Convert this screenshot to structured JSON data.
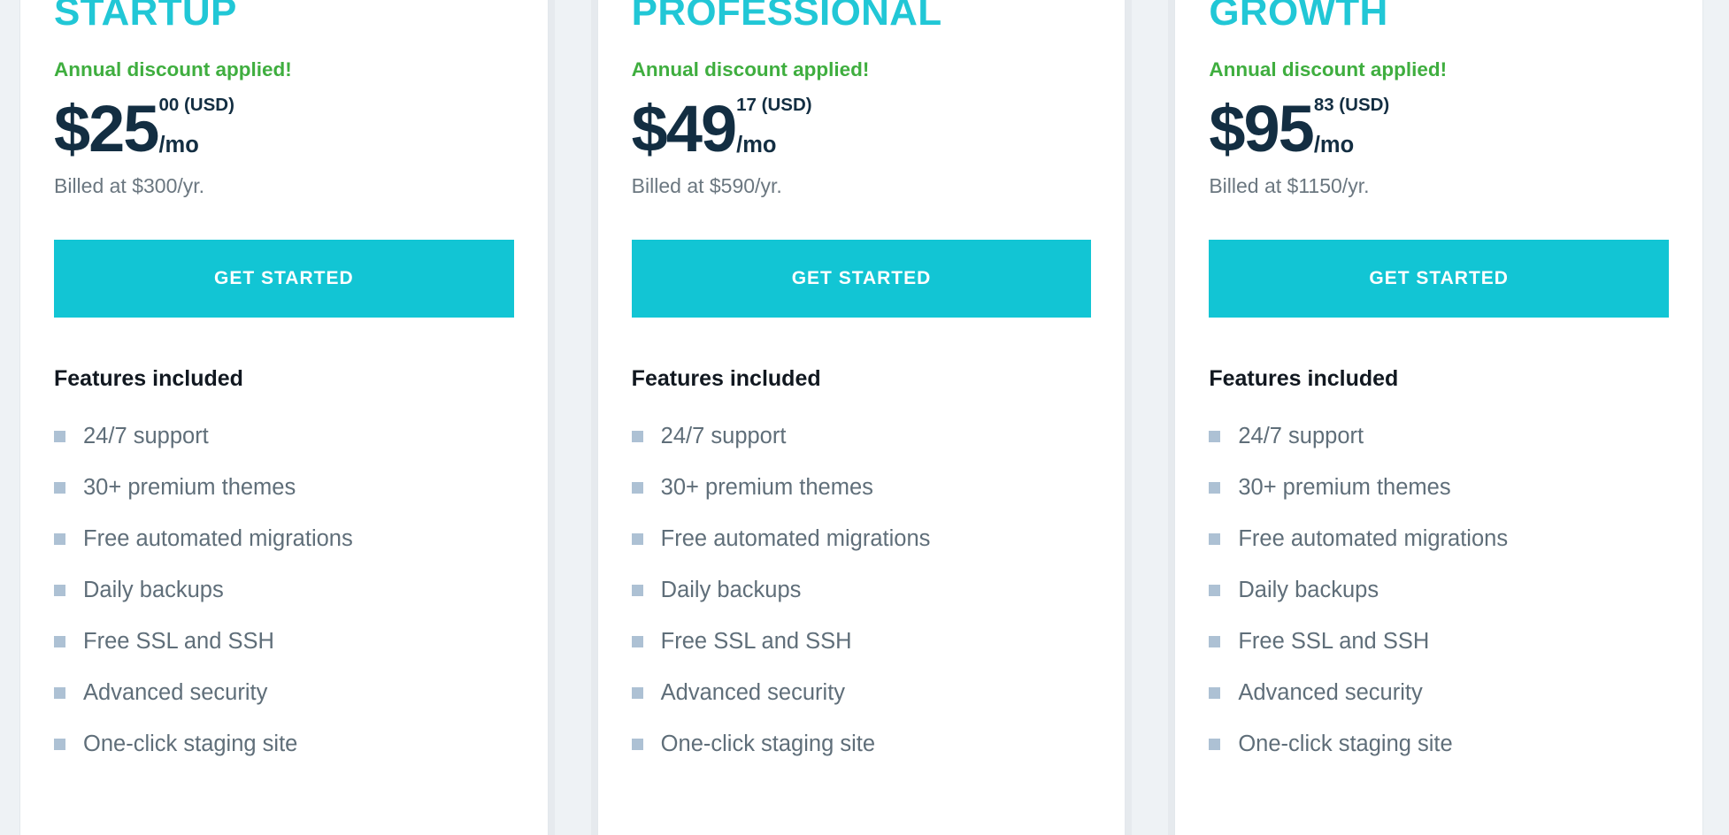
{
  "theme": {
    "accent_cyan": "#12c5d4",
    "title_cyan": "#21c7d6",
    "discount_green": "#3fae3f",
    "price_navy": "#132e42",
    "muted_gray": "#6b7780",
    "feature_gray": "#5f6e79",
    "bullet_blue": "#adc1d4",
    "page_bg": "#eef2f5",
    "card_bg": "#ffffff"
  },
  "features_heading": "Features included",
  "cta_label": "GET STARTED",
  "plans": [
    {
      "name": "STARTUP",
      "discount_note": "Annual discount applied!",
      "price_amount": "$25",
      "price_cents": "00 (USD)",
      "price_period": "/mo",
      "billed_note": "Billed at $300/yr.",
      "cta_label": "GET STARTED",
      "features_heading": "Features included",
      "features": [
        "24/7 support",
        "30+ premium themes",
        "Free automated migrations",
        "Daily backups",
        "Free SSL and SSH",
        "Advanced security",
        "One-click staging site"
      ]
    },
    {
      "name": "PROFESSIONAL",
      "discount_note": "Annual discount applied!",
      "price_amount": "$49",
      "price_cents": "17 (USD)",
      "price_period": "/mo",
      "billed_note": "Billed at $590/yr.",
      "cta_label": "GET STARTED",
      "features_heading": "Features included",
      "features": [
        "24/7 support",
        "30+ premium themes",
        "Free automated migrations",
        "Daily backups",
        "Free SSL and SSH",
        "Advanced security",
        "One-click staging site"
      ]
    },
    {
      "name": "GROWTH",
      "discount_note": "Annual discount applied!",
      "price_amount": "$95",
      "price_cents": "83 (USD)",
      "price_period": "/mo",
      "billed_note": "Billed at $1150/yr.",
      "cta_label": "GET STARTED",
      "features_heading": "Features included",
      "features": [
        "24/7 support",
        "30+ premium themes",
        "Free automated migrations",
        "Daily backups",
        "Free SSL and SSH",
        "Advanced security",
        "One-click staging site"
      ]
    }
  ]
}
